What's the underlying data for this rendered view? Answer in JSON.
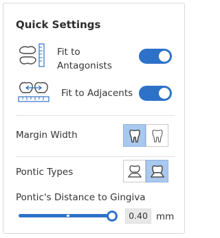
{
  "panel": {
    "title": "Quick Settings",
    "fit_antagonists": {
      "label_line1": "Fit to",
      "label_line2": "Antagonists",
      "enabled": true,
      "icon": "antagonists-ruler-icon"
    },
    "fit_adjacents": {
      "label": "Fit to Adjacents",
      "enabled": true,
      "icon": "adjacents-ruler-icon"
    },
    "margin_width": {
      "label": "Margin Width",
      "options": [
        "wide-margin-tooth-icon",
        "narrow-margin-tooth-icon"
      ],
      "selected_index": 0
    },
    "pontic_types": {
      "label": "Pontic Types",
      "options": [
        "pontic-type-1-icon",
        "pontic-type-2-icon"
      ],
      "selected_index": 1
    },
    "pontic_distance": {
      "label": "Pontic's Distance to Gingiva",
      "value": "0.40",
      "unit": "mm"
    }
  },
  "colors": {
    "accent": "#2d72c8",
    "selected_bg": "#a9c8ee"
  }
}
